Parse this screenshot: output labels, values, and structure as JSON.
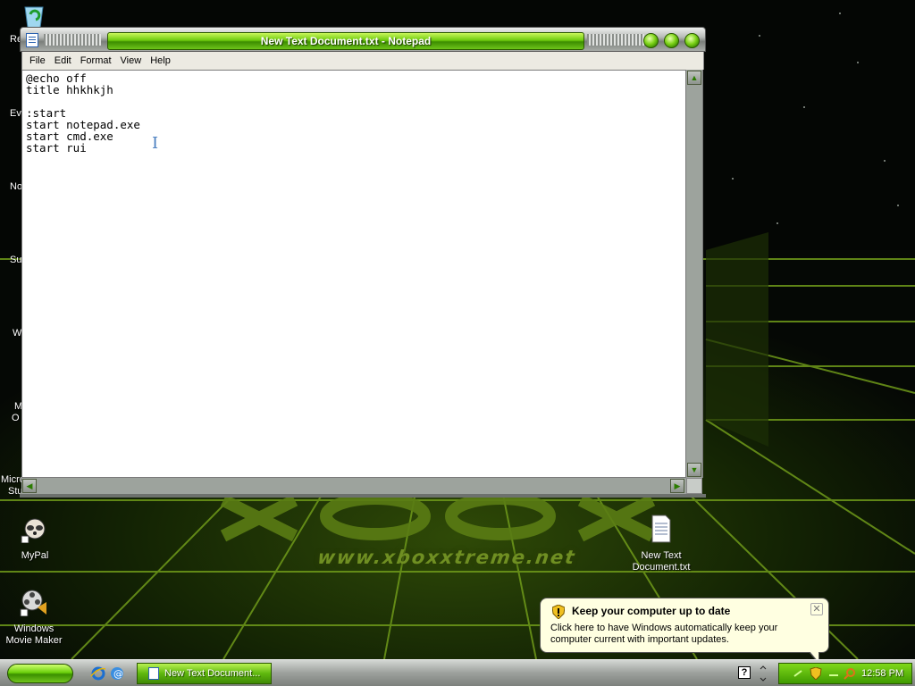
{
  "window": {
    "title": "New Text Document.txt - Notepad",
    "menu": [
      "File",
      "Edit",
      "Format",
      "View",
      "Help"
    ],
    "content": "@echo off\ntitle hhkhkjh\n\n:start\nstart notepad.exe\nstart cmd.exe\nstart rui"
  },
  "desktop": {
    "clipped_labels": [
      "Re",
      "Ev",
      "No",
      "Su",
      "W",
      "M",
      "O",
      "Micro",
      "Stu"
    ],
    "icons": [
      {
        "label": "MyPal"
      },
      {
        "label": "Windows Movie Maker"
      },
      {
        "label": "New Text Document.txt"
      }
    ],
    "wallpaper_url": "www.xboxxtreme.net"
  },
  "balloon": {
    "title": "Keep your computer up to date",
    "body": "Click here to have Windows automatically keep your computer current with important updates.",
    "close_glyph": "✕"
  },
  "taskbar": {
    "task_label": "New Text Document...",
    "help_glyph": "?",
    "clock": "12:58 PM"
  },
  "colors": {
    "accent_green": "#6ecb0e",
    "balloon_bg": "#ffffe1"
  }
}
